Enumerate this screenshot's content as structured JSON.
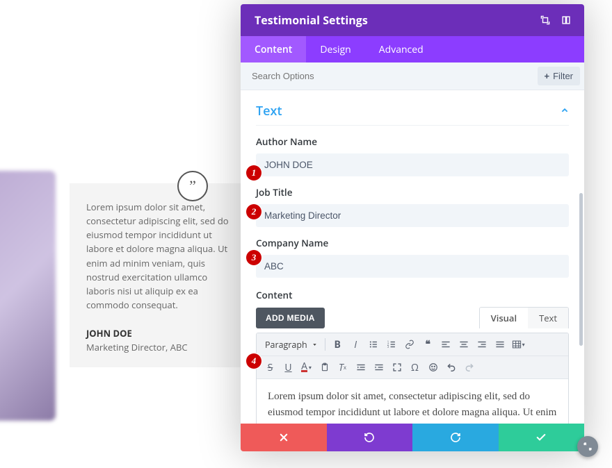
{
  "bg": {
    "testimonial_body": "Lorem ipsum dolor sit amet, consectetur adipiscing elit, sed do eiusmod tempor incididunt ut labore et dolore magna aliqua. Ut enim ad minim veniam, quis nostrud exercitation ullamco laboris nisi ut aliquip ex ea commodo consequat.",
    "author": "JOHN DOE",
    "role": "Marketing Director, ABC",
    "quote_glyph": "”"
  },
  "modal": {
    "title": "Testimonial Settings",
    "tabs": {
      "content": "Content",
      "design": "Design",
      "advanced": "Advanced"
    },
    "search_placeholder": "Search Options",
    "filter_label": "Filter",
    "section_text": "Text",
    "fields": {
      "author_label": "Author Name",
      "author_value": "JOHN DOE",
      "job_label": "Job Title",
      "job_value": "Marketing Director",
      "company_label": "Company Name",
      "company_value": "ABC",
      "content_label": "Content"
    },
    "editor": {
      "add_media": "ADD MEDIA",
      "vt_visual": "Visual",
      "vt_text": "Text",
      "paragraph": "Paragraph",
      "body": "Lorem ipsum dolor sit amet, consectetur adipiscing elit, sed do eiusmod tempor incididunt ut labore et dolore magna aliqua. Ut enim ad minim veniam, quis nostrud exercitation ullamco laboris nisi ut aliquip ex ea commodo consequat."
    }
  },
  "callouts": {
    "one": "1",
    "two": "2",
    "three": "3",
    "four": "4"
  }
}
